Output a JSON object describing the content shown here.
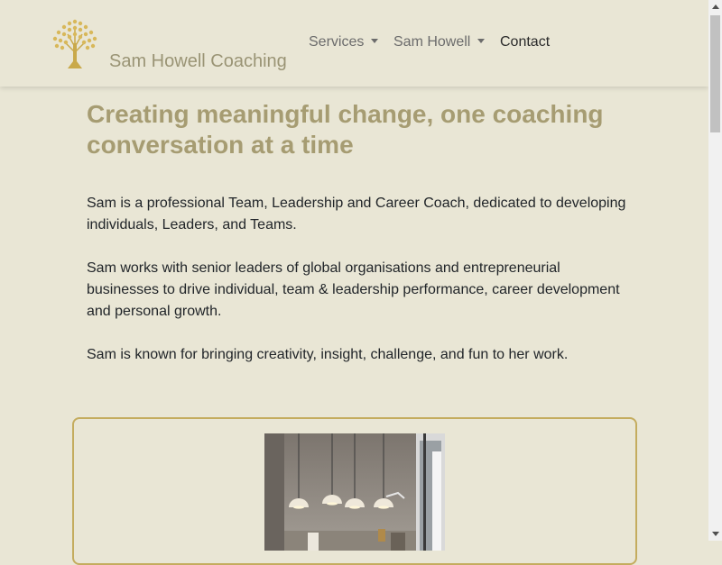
{
  "navbar": {
    "brand": "Sam Howell Coaching",
    "logo_icon": "tree-icon",
    "items": [
      {
        "label": "Services",
        "dropdown": true
      },
      {
        "label": "Sam Howell",
        "dropdown": true
      },
      {
        "label": "Contact",
        "dropdown": false
      }
    ]
  },
  "main": {
    "headline": "Creating meaningful change, one coaching conversation at a time",
    "paragraphs": [
      "Sam is a professional Team, Leadership and Career Coach, dedicated to developing individuals, Leaders, and Teams.",
      "Sam works with senior leaders of global organisations and entrepreneurial businesses to drive individual, team & leadership performance, career development and personal growth.",
      "Sam is known for bringing creativity, insight, challenge, and fun to her work."
    ]
  },
  "card": {
    "image_subject": "office-interior-photo"
  },
  "colors": {
    "background": "#e9e6d5",
    "accent_gold": "#c4ac5e",
    "headline": "#a69c72",
    "brand_text": "#9a9475"
  }
}
